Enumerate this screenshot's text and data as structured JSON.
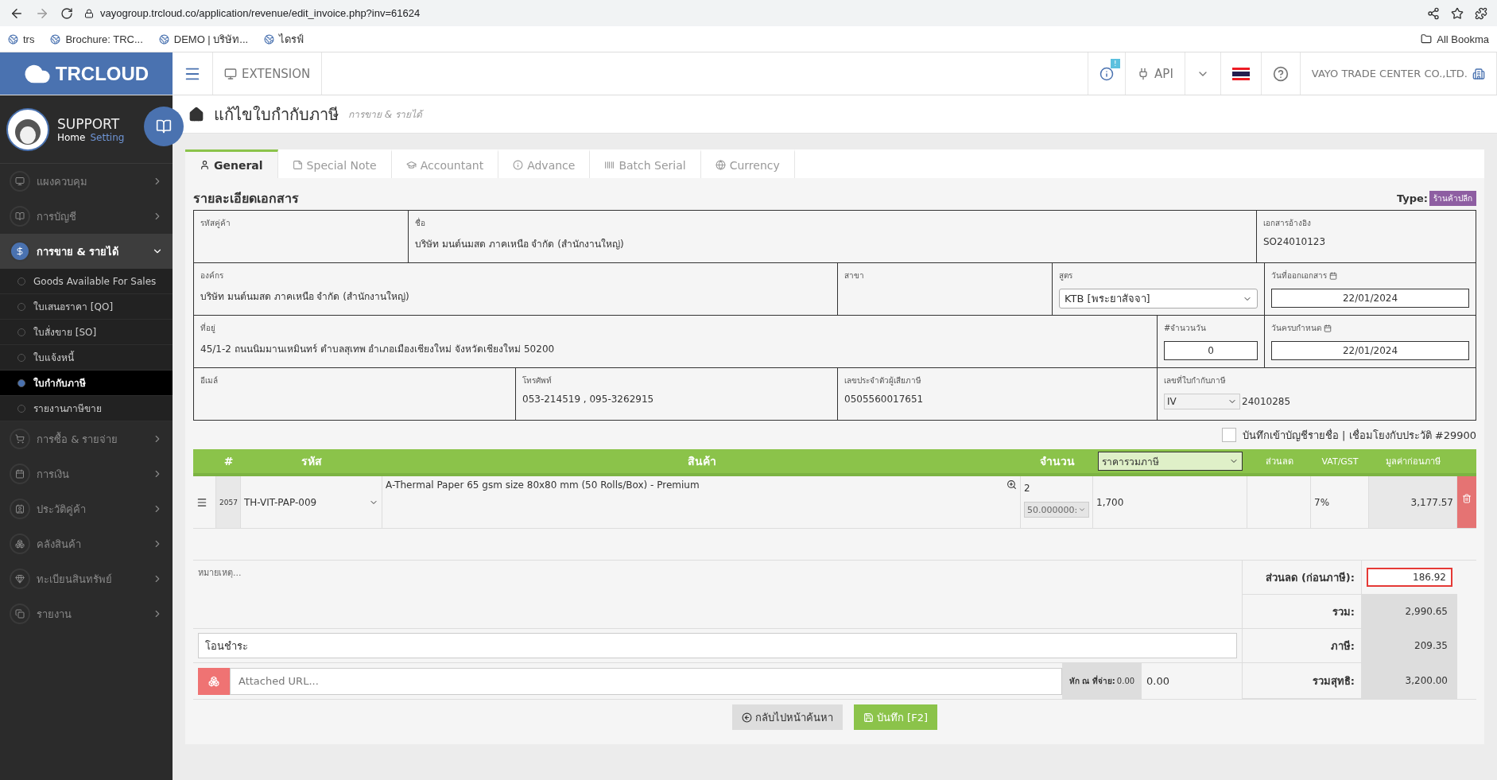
{
  "browser": {
    "url": "vayogroup.trcloud.co/application/revenue/edit_invoice.php?inv=61624",
    "bookmarks": [
      "trs",
      "Brochure: TRC...",
      "DEMO | บริษัท...",
      "ไดรฟ์"
    ],
    "all_bookmarks": "All Bookma"
  },
  "header": {
    "logo": "TRCLOUD",
    "extension": "EXTENSION",
    "notice_badge": "!",
    "api": "API",
    "company": "VAYO TRADE CENTER CO.,LTD."
  },
  "sidebar": {
    "user": "SUPPORT",
    "links": [
      {
        "label": "Home",
        "selected": true
      },
      {
        "label": "Setting",
        "selected": false
      }
    ],
    "items": [
      {
        "label": "แผงควบคุม",
        "expanded": false,
        "selected": false
      },
      {
        "label": "การบัญชี",
        "expanded": false,
        "selected": false
      },
      {
        "label": "การขาย & รายได้",
        "expanded": true,
        "selected": true,
        "children": [
          {
            "label": "Goods Available For Sales",
            "selected": false
          },
          {
            "label": "ใบเสนอราคา [QO]",
            "selected": false
          },
          {
            "label": "ใบสั่งขาย [SO]",
            "selected": false
          },
          {
            "label": "ใบแจ้งหนี้",
            "selected": false
          },
          {
            "label": "ใบกำกับภาษี",
            "selected": true
          },
          {
            "label": "รายงานภาษีขาย",
            "selected": false
          }
        ]
      },
      {
        "label": "การซื้อ & รายจ่าย",
        "expanded": false,
        "selected": false
      },
      {
        "label": "การเงิน",
        "expanded": false,
        "selected": false
      },
      {
        "label": "ประวัติคู่ค้า",
        "expanded": false,
        "selected": false
      },
      {
        "label": "คลังสินค้า",
        "expanded": false,
        "selected": false
      },
      {
        "label": "ทะเบียนสินทรัพย์",
        "expanded": false,
        "selected": false
      },
      {
        "label": "รายงาน",
        "expanded": false,
        "selected": false
      }
    ]
  },
  "page": {
    "title": "แก้ไขใบกำกับภาษี",
    "subtitle": "การขาย & รายได้"
  },
  "tabs": [
    {
      "label": "General",
      "selected": true
    },
    {
      "label": "Special Note",
      "selected": false
    },
    {
      "label": "Accountant",
      "selected": false
    },
    {
      "label": "Advance",
      "selected": false
    },
    {
      "label": "Batch Serial",
      "selected": false
    },
    {
      "label": "Currency",
      "selected": false
    }
  ],
  "section": {
    "title": "รายละเอียดเอกสาร",
    "type_label": "Type:",
    "type_badge": "ร้านค้าปลีก"
  },
  "form_rows": [
    [
      {
        "label": "รหัสคู่ค้า",
        "kind": "text"
      },
      {
        "label": "ชื่อ",
        "kind": "text",
        "value": "บริษัท มนต์นมสด ภาคเหนือ จำกัด (สำนักงานใหญ่)"
      },
      {
        "label": "เอกสารอ้างอิง",
        "kind": "text",
        "value": "SO24010123"
      }
    ],
    [
      {
        "label": "องค์กร",
        "kind": "text",
        "value": "บริษัท มนต์นมสด ภาคเหนือ จำกัด (สำนักงานใหญ่)"
      },
      {
        "label": "สาขา",
        "kind": "text"
      },
      {
        "label": "สูตร",
        "kind": "select",
        "value": "KTB [พระยาสัจจา]"
      },
      {
        "label": "วันที่ออกเอกสาร",
        "kind": "date",
        "value": "22/01/2024"
      }
    ],
    [
      {
        "label": "ที่อยู่",
        "kind": "text",
        "value": "45/1-2 ถนนนิมมานเหมินทร์ ตำบลสุเทพ อำเภอเมืองเชียงใหม่ จังหวัดเชียงใหม่ 50200"
      },
      {
        "label": "#จำนวนวัน",
        "kind": "input",
        "value": "0"
      },
      {
        "label": "วันครบกำหนด",
        "kind": "date",
        "value": "22/01/2024"
      }
    ],
    [
      {
        "label": "อีเมล์",
        "kind": "text"
      },
      {
        "label": "โทรศัพท์",
        "kind": "text",
        "value": "053-214519 , 095-3262915"
      },
      {
        "label": "เลขประจำตัวผู้เสียภาษี",
        "kind": "text",
        "value": "0505560017651"
      },
      {
        "label": "เลขที่ใบกำกับภาษี",
        "kind": "prefixed",
        "prefix": "IV",
        "value": "24010285"
      }
    ]
  ],
  "link_ledger": {
    "label": "บันทึกเข้าบัญชีรายชื่อ | เชื่อมโยงกับประวัติ #29900",
    "checked": false
  },
  "table": {
    "columns": [
      "#",
      "รหัส",
      "สินค้า",
      "จำนวน",
      "ส่วนลด",
      "VAT/GST",
      "มูลค่าก่อนภาษี"
    ],
    "price_mode": "ราคารวมภาษี",
    "rows": [
      {
        "index": "2057",
        "code": "TH-VIT-PAP-009",
        "description": "A-Thermal Paper 65 gsm size 80x80 mm (50 Rolls/Box) - Premium",
        "qty": "2",
        "unit": "50.000000:",
        "price": "1,700",
        "vat": "7%",
        "amount": "3,177.57"
      }
    ]
  },
  "notes_placeholder": "หมายเหตุ...",
  "payment": "โอนชำระ",
  "attach_placeholder": "Attached URL...",
  "withholding": {
    "label": "หัก ณ ที่จ่าย:",
    "rate": "0.00",
    "value": "0.00"
  },
  "totals": [
    {
      "label": "ส่วนลด (ก่อนภาษี):",
      "value": "186.92",
      "editable": true
    },
    {
      "label": "รวม:",
      "value": "2,990.65",
      "editable": false
    },
    {
      "label": "ภาษี:",
      "value": "209.35",
      "editable": false
    },
    {
      "label": "รวมสุทธิ:",
      "value": "3,200.00",
      "editable": false
    }
  ],
  "buttons": [
    {
      "label": "กลับไปหน้าค้นหา",
      "kind": "back"
    },
    {
      "label": "บันทึก [F2]",
      "kind": "save"
    }
  ]
}
